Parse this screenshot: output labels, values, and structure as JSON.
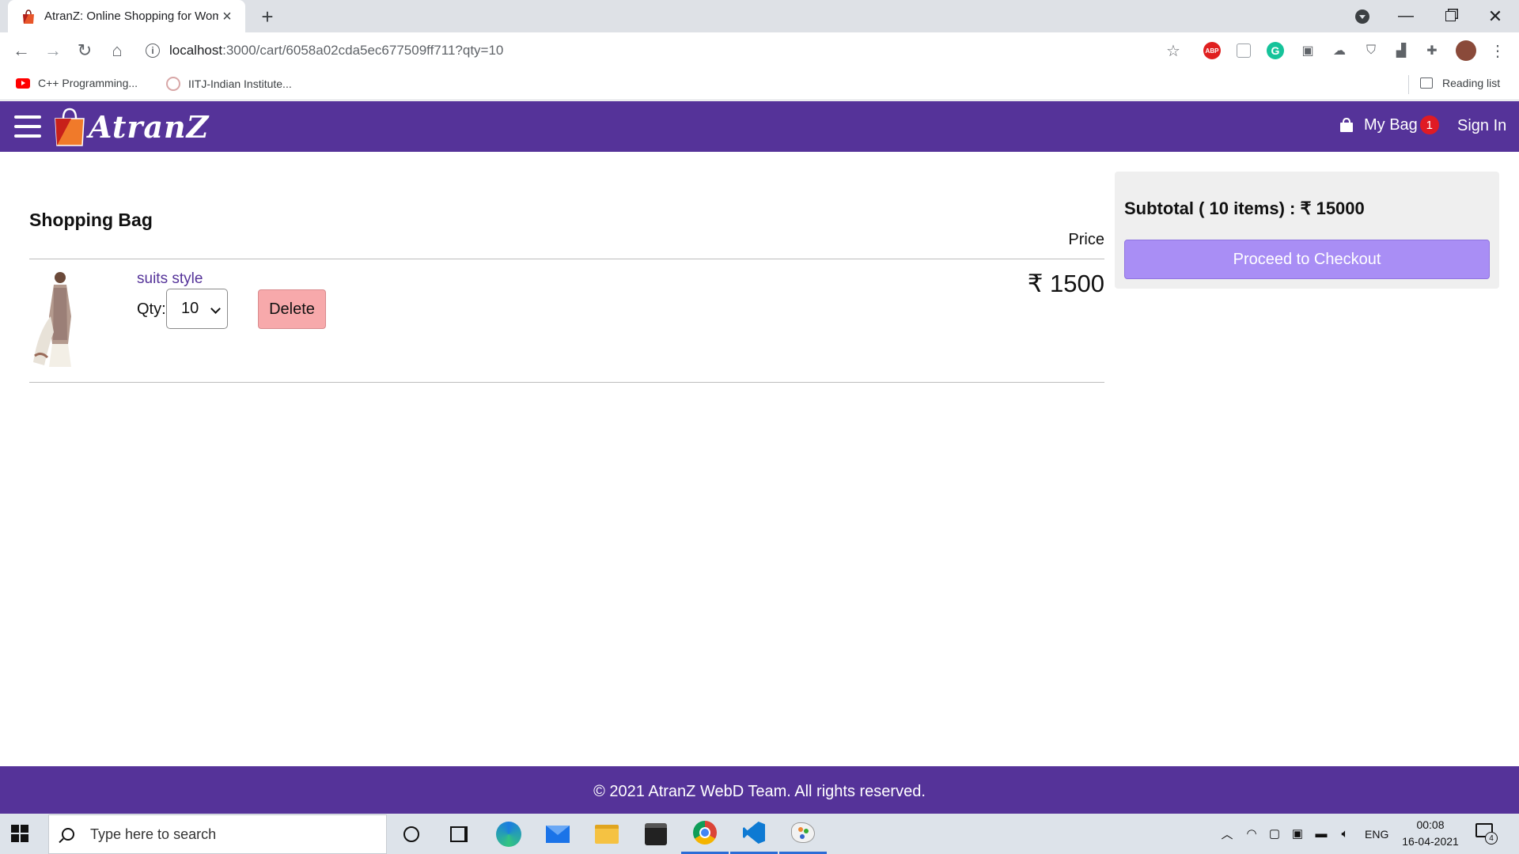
{
  "browser": {
    "tab_title": "AtranZ: Online Shopping for Women",
    "url_host": "localhost",
    "url_path": ":3000/cart/6058a02cda5ec677509ff711?qty=10",
    "bookmarks": [
      {
        "label": "C++ Programming..."
      },
      {
        "label": "IITJ-Indian Institute..."
      }
    ],
    "reading_list": "Reading list",
    "ext_abp": "ABP",
    "ext_grammarly": "G"
  },
  "header": {
    "logo_text": "AtranZ",
    "bag_label": "My Bag",
    "bag_count": "1",
    "signin_label": "Sign In",
    "brand_color": "#553399"
  },
  "cart": {
    "title": "Shopping Bag",
    "price_header": "Price",
    "items": [
      {
        "name": "suits style",
        "qty_label": "Qty:",
        "qty_value": "10",
        "delete_label": "Delete",
        "price": "₹ 1500"
      }
    ]
  },
  "summary": {
    "subtotal_text": "Subtotal ( 10 items) : ₹  15000",
    "checkout_label": "Proceed to Checkout"
  },
  "footer": {
    "text": "© 2021 AtranZ WebD Team. All rights reserved."
  },
  "taskbar": {
    "search_placeholder": "Type here to search",
    "lang": "ENG",
    "time": "00:08",
    "date": "16-04-2021",
    "notification_count": "4"
  }
}
